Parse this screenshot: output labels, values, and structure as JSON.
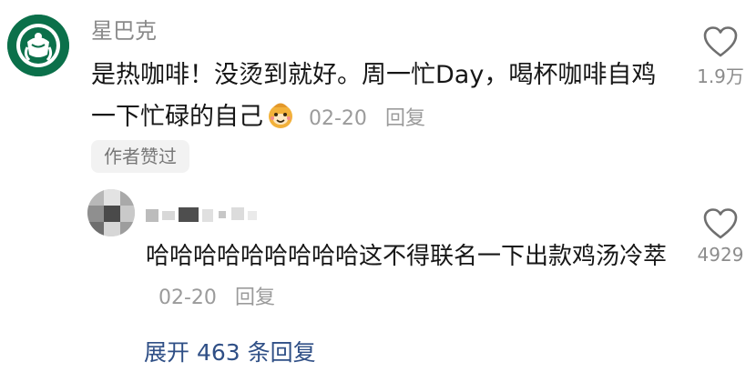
{
  "comment": {
    "author": "星巴克",
    "text": "是热咖啡！没烫到就好。周一忙Day，喝杯咖啡自鸡一下忙碌的自己",
    "emoji": "smiling-mascot-emoji",
    "date": "02-20",
    "reply_label": "回复",
    "likes": "1.9万",
    "author_liked_badge": "作者赞过"
  },
  "reply": {
    "author_name_redacted": true,
    "text": "哈哈哈哈哈哈哈哈哈这不得联名一下出款鸡汤冷萃",
    "date": "02-20",
    "reply_label": "回复",
    "likes": "4929"
  },
  "expand_replies": "展开 463 条回复",
  "colors": {
    "starbucks_green": "#0b704a",
    "link_blue": "#2f4f86",
    "meta_gray": "#9b9b9b"
  }
}
